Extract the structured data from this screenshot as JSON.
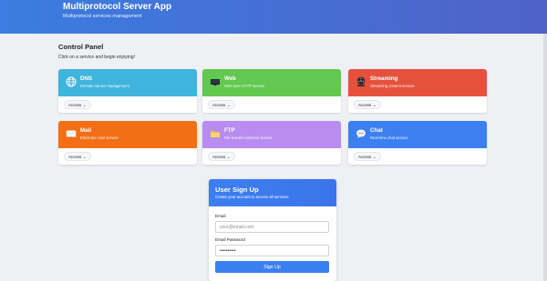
{
  "header": {
    "title": "Multiprotocol Server App",
    "subtitle": "Multiprotocol services management"
  },
  "panel": {
    "title": "Control Panel",
    "subtitle": "Click on a service and begin enjoying!"
  },
  "services": [
    {
      "title": "DNS",
      "desc": "Domain names management",
      "access": "Access →",
      "color": "#3fb4dc",
      "icon": "globe-icon"
    },
    {
      "title": "Web",
      "desc": "Web over HTTP service",
      "access": "Access →",
      "color": "#62c84f",
      "icon": "monitor-icon"
    },
    {
      "title": "Streaming",
      "desc": "Streaming content service",
      "access": "Access →",
      "color": "#e6513d",
      "icon": "film-reel-icon"
    },
    {
      "title": "Mail",
      "desc": "Electronic mail service",
      "access": "Access →",
      "color": "#f26f16",
      "icon": "envelope-icon"
    },
    {
      "title": "FTP",
      "desc": "File transfer protocol service",
      "access": "Access →",
      "color": "#b98cf0",
      "icon": "folder-icon"
    },
    {
      "title": "Chat",
      "desc": "Real-time chat service",
      "access": "Access →",
      "color": "#3c7ff0",
      "icon": "speech-bubble-icon"
    }
  ],
  "signup": {
    "title": "User Sign Up",
    "subtitle": "Create your account to access all services",
    "email_label": "Email",
    "email_placeholder": "your@email.com",
    "password_label": "Email Password",
    "password_value": "••••••••••",
    "button_label": "Sign Up"
  }
}
